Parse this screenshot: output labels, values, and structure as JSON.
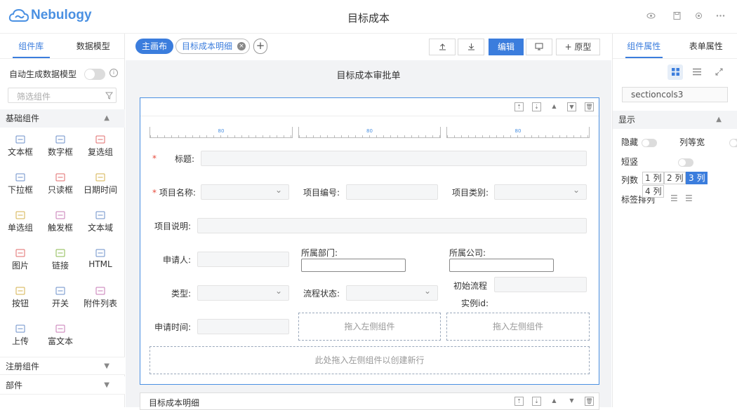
{
  "header": {
    "logo": "Nebulogy",
    "title": "目标成本",
    "icons": [
      "eye-icon",
      "save-icon",
      "settings-icon",
      "more-icon"
    ]
  },
  "left": {
    "tabs": [
      "组件库",
      "数据模型"
    ],
    "auto_model_label": "自动生成数据模型",
    "filter_placeholder": "筛选组件",
    "sections": {
      "basic": "基础组件",
      "registered": "注册组件",
      "parts": "部件"
    },
    "components": [
      "文本框",
      "数字框",
      "复选组",
      "下拉框",
      "只读框",
      "日期时间",
      "单选组",
      "触发框",
      "文本域",
      "图片",
      "链接",
      "HTML",
      "按钮",
      "开关",
      "附件列表",
      "上传",
      "富文本"
    ]
  },
  "middle": {
    "chip_main": "主画布",
    "chip_detail": "目标成本明细",
    "btn_edit": "编辑",
    "btn_prototype": "+ 原型",
    "form_title": "目标成本审批单",
    "ruler_label": "80",
    "fields": {
      "title": "标题:",
      "project_name": "项目名称:",
      "project_no": "项目编号:",
      "project_type": "项目类别:",
      "project_desc": "项目说明:",
      "applicant": "申请人:",
      "dept": "所属部门:",
      "company": "所属公司:",
      "type": "类型:",
      "flow_status": "流程状态:",
      "init_flow": "初始流程",
      "instance_id": "实例id:",
      "apply_time": "申请时间:"
    },
    "drop_hint": "拖入左侧组件",
    "drop_new_row": "此处拖入左侧组件以创建新行",
    "section2_title": "目标成本明细"
  },
  "right": {
    "tabs": [
      "组件属性",
      "表单属性"
    ],
    "component_id": "sectioncols3",
    "display_label": "显示",
    "hide_label": "隐藏",
    "equal_width_label": "列等宽",
    "short_vertical_label": "短竖",
    "columns_label": "列数",
    "col_options": [
      "1 列",
      "2 列",
      "3 列",
      "4 列"
    ],
    "selected_col": "3 列",
    "label_align": "标签排列"
  },
  "colors": {
    "accent": "#3b7ddd",
    "brand": "#4a90e2",
    "canvas": "#f2f3f5"
  }
}
